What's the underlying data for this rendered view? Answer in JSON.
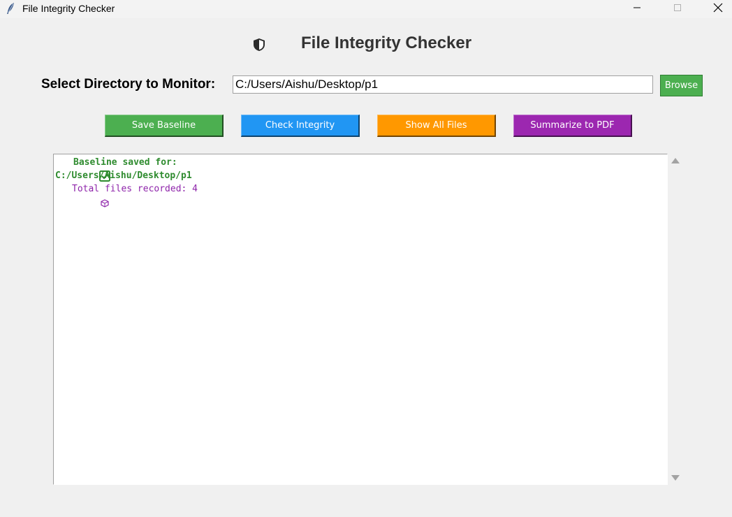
{
  "window": {
    "title": "File Integrity Checker",
    "controls": {
      "minimize_icon": "minimize-icon",
      "maximize_icon": "maximize-icon",
      "close_icon": "close-icon"
    },
    "app_icon": "feather-icon"
  },
  "header": {
    "icon": "shield-icon",
    "title": "File Integrity Checker"
  },
  "directory": {
    "label": "Select Directory to Monitor:",
    "value": "C:/Users/Aishu/Desktop/p1",
    "browse_label": "Browse"
  },
  "actions": {
    "save_baseline": "Save Baseline",
    "check_integrity": "Check Integrity",
    "show_all_files": "Show All Files",
    "summarize_pdf": "Summarize to PDF"
  },
  "colors": {
    "save_baseline": "#4caf50",
    "check_integrity": "#2196f3",
    "show_all_files": "#ff9800",
    "summarize_pdf": "#9c27b0",
    "browse": "#4caf50",
    "log_success": "#2e8b2e",
    "log_info": "#8e24aa"
  },
  "output": {
    "lines": [
      {
        "icon": "check-box-icon",
        "text": "Baseline saved for:"
      },
      {
        "icon": "",
        "text": "C:/Users/Aishu/Desktop/p1"
      },
      {
        "icon": "package-icon",
        "text": "Total files recorded: 4"
      }
    ]
  }
}
